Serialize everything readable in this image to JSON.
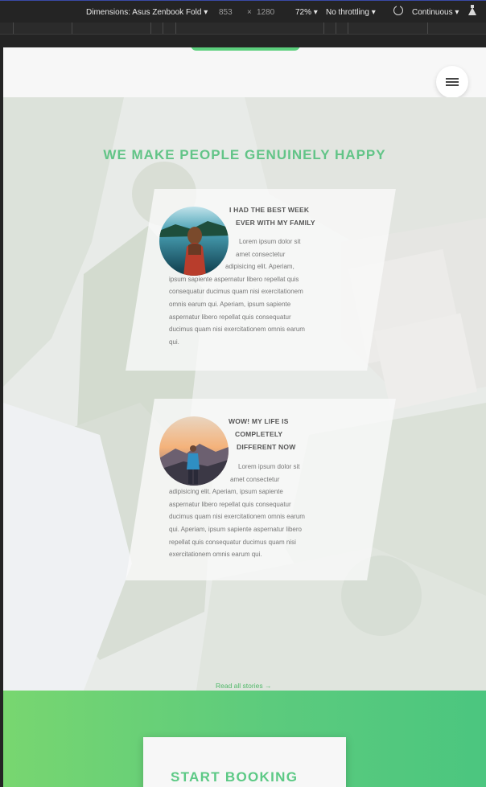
{
  "devtools": {
    "dimensions_label": "Dimensions: Asus Zenbook Fold",
    "width": "853",
    "times": "×",
    "height": "1280",
    "zoom": "72%",
    "throttling": "No throttling",
    "continuous": "Continuous",
    "dropdown_caret": "▾"
  },
  "hero": {
    "title": "WE MAKE PEOPLE GENUINELY HAPPY",
    "read_all": "Read all stories →"
  },
  "stories": [
    {
      "title_line1": "I HAD THE BEST WEEK",
      "title_line2": "EVER WITH MY FAMILY",
      "body_lines": [
        "Lorem ipsum dolor sit",
        "amet consectetur",
        "adipisicing elit. Aperiam,",
        "ipsum sapiente aspernatur libero repellat quis",
        "consequatur ducimus quam nisi exercitationem",
        "omnis earum qui. Aperiam, ipsum sapiente",
        "aspernatur libero repellat quis consequatur",
        "ducimus quam nisi exercitationem omnis earum",
        "qui."
      ]
    },
    {
      "title_line1": "WOW! MY LIFE IS",
      "title_line2": "COMPLETELY",
      "title_line3": "DIFFERENT NOW",
      "body_lines": [
        "Lorem ipsum dolor sit",
        "amet consectetur",
        "adipisicing elit. Aperiam, ipsum sapiente",
        "aspernatur libero repellat quis consequatur",
        "ducimus quam nisi exercitationem omnis earum",
        "qui. Aperiam, ipsum sapiente aspernatur libero",
        "repellat quis consequatur ducimus quam nisi",
        "exercitationem omnis earum qui."
      ]
    }
  ],
  "booking": {
    "title": "START BOOKING"
  },
  "colors": {
    "accent_green": "#5ccf7d",
    "title_green": "#62c487"
  },
  "icons": {
    "menu": "hamburger-menu-icon",
    "rotate": "rotate-icon",
    "experiments": "flask-icon"
  }
}
